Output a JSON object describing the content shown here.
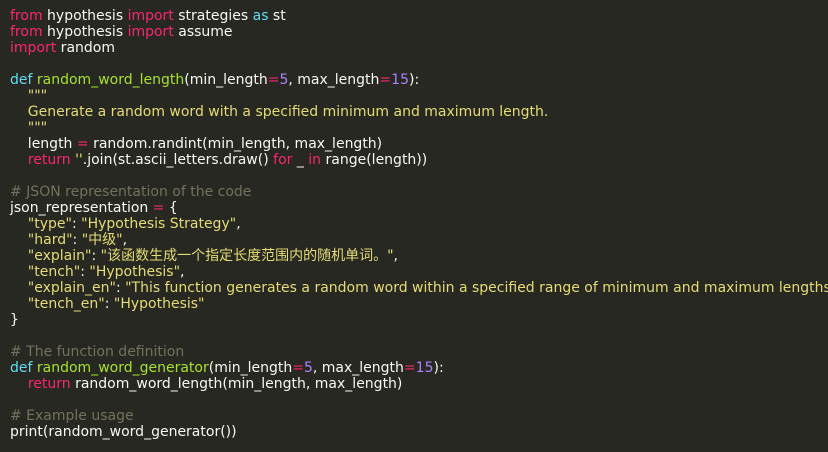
{
  "editor": {
    "theme": "monokai",
    "colors": {
      "background": "#272822",
      "text": "#f8f8f2",
      "keyword": "#f92672",
      "def": "#66d9ef",
      "function": "#a6e22e",
      "number": "#ae81ff",
      "string": "#e6db74",
      "comment": "#75715e"
    },
    "lines": [
      [
        {
          "t": "kw",
          "v": "from"
        },
        {
          "t": "txt",
          "v": " hypothesis "
        },
        {
          "t": "kw",
          "v": "import"
        },
        {
          "t": "txt",
          "v": " strategies "
        },
        {
          "t": "def",
          "v": "as"
        },
        {
          "t": "txt",
          "v": " st"
        }
      ],
      [
        {
          "t": "kw",
          "v": "from"
        },
        {
          "t": "txt",
          "v": " hypothesis "
        },
        {
          "t": "kw",
          "v": "import"
        },
        {
          "t": "txt",
          "v": " assume"
        }
      ],
      [
        {
          "t": "kw",
          "v": "import"
        },
        {
          "t": "txt",
          "v": " random"
        }
      ],
      [],
      [
        {
          "t": "def",
          "v": "def"
        },
        {
          "t": "txt",
          "v": " "
        },
        {
          "t": "fn",
          "v": "random_word_length"
        },
        {
          "t": "txt",
          "v": "(min_length"
        },
        {
          "t": "op",
          "v": "="
        },
        {
          "t": "num",
          "v": "5"
        },
        {
          "t": "txt",
          "v": ", max_length"
        },
        {
          "t": "op",
          "v": "="
        },
        {
          "t": "num",
          "v": "15"
        },
        {
          "t": "txt",
          "v": "):"
        }
      ],
      [
        {
          "t": "str",
          "v": "    \"\"\""
        }
      ],
      [
        {
          "t": "str",
          "v": "    Generate a random word with a specified minimum and maximum length."
        }
      ],
      [
        {
          "t": "str",
          "v": "    \"\"\""
        }
      ],
      [
        {
          "t": "txt",
          "v": "    length "
        },
        {
          "t": "op",
          "v": "="
        },
        {
          "t": "txt",
          "v": " random.randint(min_length, max_length)"
        }
      ],
      [
        {
          "t": "txt",
          "v": "    "
        },
        {
          "t": "kw",
          "v": "return"
        },
        {
          "t": "txt",
          "v": " "
        },
        {
          "t": "str",
          "v": "''"
        },
        {
          "t": "txt",
          "v": ".join(st.ascii_letters.draw() "
        },
        {
          "t": "kw",
          "v": "for"
        },
        {
          "t": "txt",
          "v": " _ "
        },
        {
          "t": "kw",
          "v": "in"
        },
        {
          "t": "txt",
          "v": " range(length))"
        }
      ],
      [],
      [
        {
          "t": "cmt",
          "v": "# JSON representation of the code"
        }
      ],
      [
        {
          "t": "txt",
          "v": "json_representation "
        },
        {
          "t": "op",
          "v": "="
        },
        {
          "t": "txt",
          "v": " {"
        }
      ],
      [
        {
          "t": "str",
          "v": "    \"type\""
        },
        {
          "t": "txt",
          "v": ": "
        },
        {
          "t": "str",
          "v": "\"Hypothesis Strategy\""
        },
        {
          "t": "txt",
          "v": ","
        }
      ],
      [
        {
          "t": "str",
          "v": "    \"hard\""
        },
        {
          "t": "txt",
          "v": ": "
        },
        {
          "t": "str",
          "v": "\"中级\""
        },
        {
          "t": "txt",
          "v": ","
        }
      ],
      [
        {
          "t": "str",
          "v": "    \"explain\""
        },
        {
          "t": "txt",
          "v": ": "
        },
        {
          "t": "str",
          "v": "\"该函数生成一个指定长度范围内的随机单词。\""
        },
        {
          "t": "txt",
          "v": ","
        }
      ],
      [
        {
          "t": "str",
          "v": "    \"tench\""
        },
        {
          "t": "txt",
          "v": ": "
        },
        {
          "t": "str",
          "v": "\"Hypothesis\""
        },
        {
          "t": "txt",
          "v": ","
        }
      ],
      [
        {
          "t": "str",
          "v": "    \"explain_en\""
        },
        {
          "t": "txt",
          "v": ": "
        },
        {
          "t": "str",
          "v": "\"This function generates a random word within a specified range of minimum and maximum lengths.\""
        },
        {
          "t": "txt",
          "v": ","
        }
      ],
      [
        {
          "t": "str",
          "v": "    \"tench_en\""
        },
        {
          "t": "txt",
          "v": ": "
        },
        {
          "t": "str",
          "v": "\"Hypothesis\""
        }
      ],
      [
        {
          "t": "txt",
          "v": "}"
        }
      ],
      [],
      [
        {
          "t": "cmt",
          "v": "# The function definition"
        }
      ],
      [
        {
          "t": "def",
          "v": "def"
        },
        {
          "t": "txt",
          "v": " "
        },
        {
          "t": "fn",
          "v": "random_word_generator"
        },
        {
          "t": "txt",
          "v": "(min_length"
        },
        {
          "t": "op",
          "v": "="
        },
        {
          "t": "num",
          "v": "5"
        },
        {
          "t": "txt",
          "v": ", max_length"
        },
        {
          "t": "op",
          "v": "="
        },
        {
          "t": "num",
          "v": "15"
        },
        {
          "t": "txt",
          "v": "):"
        }
      ],
      [
        {
          "t": "txt",
          "v": "    "
        },
        {
          "t": "kw",
          "v": "return"
        },
        {
          "t": "txt",
          "v": " random_word_length(min_length, max_length)"
        }
      ],
      [],
      [
        {
          "t": "cmt",
          "v": "# Example usage"
        }
      ],
      [
        {
          "t": "txt",
          "v": "print(random_word_generator())"
        }
      ]
    ]
  }
}
